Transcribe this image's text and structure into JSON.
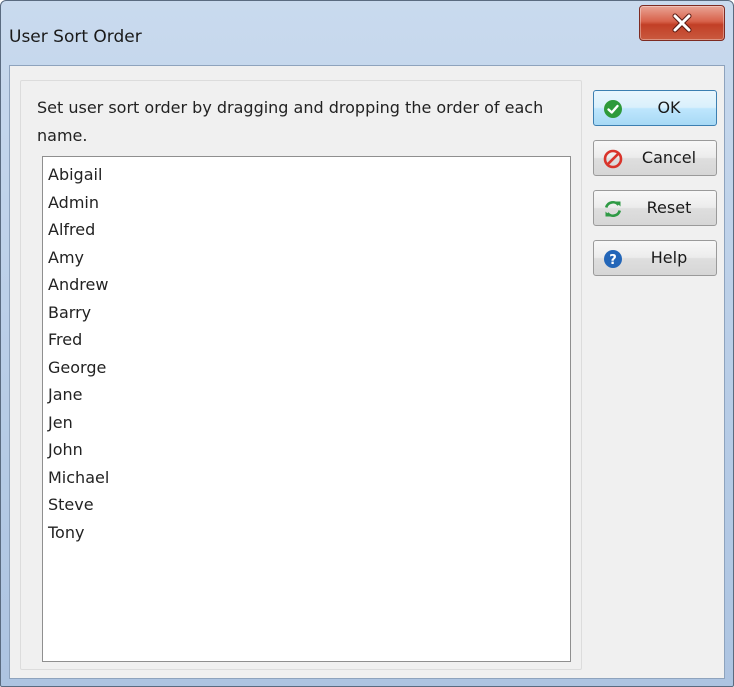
{
  "window": {
    "title": "User Sort Order"
  },
  "instruction": "Set user sort order by dragging and dropping the order of each name.",
  "names": [
    "Abigail",
    "Admin",
    "Alfred",
    "Amy",
    "Andrew",
    "Barry",
    "Fred",
    "George",
    "Jane",
    "Jen",
    "John",
    "Michael",
    "Steve",
    "Tony"
  ],
  "buttons": {
    "ok": "OK",
    "cancel": "Cancel",
    "reset": "Reset",
    "help": "Help"
  },
  "icons": {
    "close": "close-icon",
    "ok": "check-circle-icon",
    "cancel": "prohibited-icon",
    "reset": "refresh-icon",
    "help": "question-circle-icon"
  },
  "colors": {
    "ok_icon": "#2e9a3a",
    "cancel_icon": "#d9342b",
    "reset_icon": "#2f9a45",
    "help_icon": "#2366b8",
    "close_button": "#c95a3f"
  }
}
